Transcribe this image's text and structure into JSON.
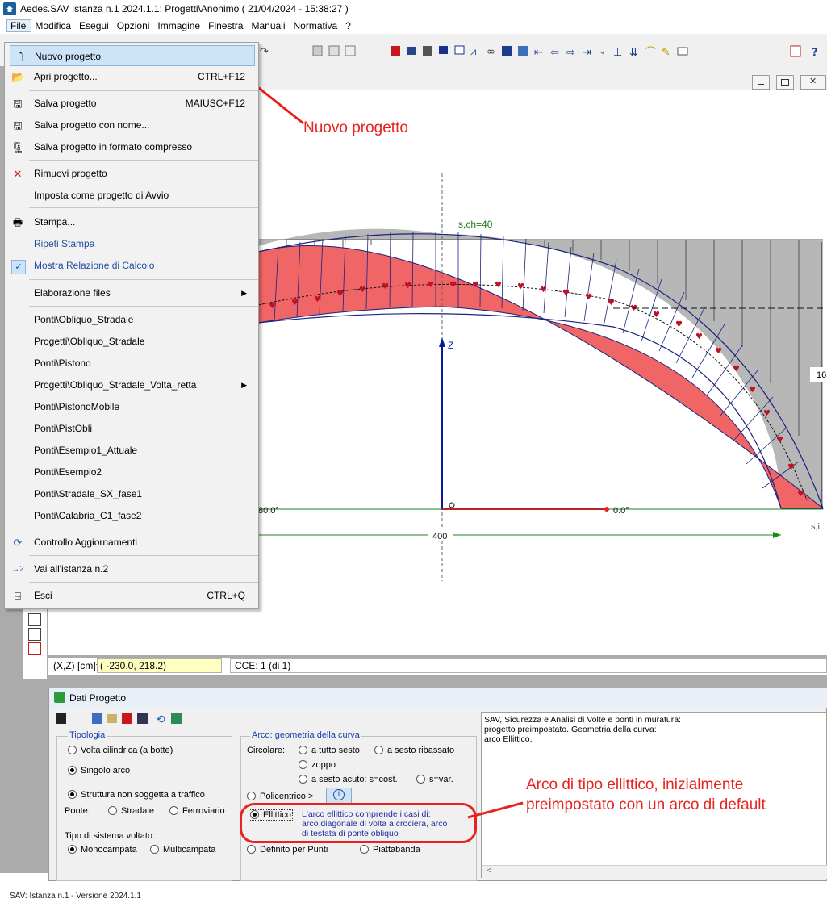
{
  "title_bar": {
    "text": "Aedes.SAV Istanza n.1 2024.1.1: Progetti\\Anonimo  ( 21/04/2024 - 15:38:27 )"
  },
  "menubar": [
    "File",
    "Modifica",
    "Esegui",
    "Opzioni",
    "Immagine",
    "Finestra",
    "Manuali",
    "Normativa",
    "?"
  ],
  "file_menu": [
    {
      "label": "Nuovo progetto",
      "icon": "new-document-icon",
      "shortcut": ""
    },
    {
      "label": "Apri progetto...",
      "icon": "open-folder-icon",
      "shortcut": "CTRL+F12"
    },
    {
      "label": "Salva progetto",
      "icon": "floppy-disk-icon",
      "shortcut": "MAIUSC+F12"
    },
    {
      "label": "Salva progetto con nome...",
      "icon": "floppy-save-as-icon",
      "shortcut": ""
    },
    {
      "label": "Salva progetto in formato compresso",
      "icon": "compressed-save-icon",
      "shortcut": ""
    },
    {
      "label": "Rimuovi progetto",
      "icon": "red-x-icon",
      "shortcut": ""
    },
    {
      "label": "Imposta come progetto di Avvio",
      "icon": "",
      "shortcut": ""
    },
    {
      "label": "Stampa...",
      "icon": "printer-icon",
      "shortcut": ""
    },
    {
      "label": "Ripeti Stampa",
      "icon": "",
      "shortcut": ""
    },
    {
      "label": "Mostra Relazione di Calcolo",
      "icon": "checkmark-icon",
      "shortcut": ""
    },
    {
      "label": "Elaborazione files",
      "icon": "",
      "shortcut": ""
    },
    {
      "label": "Ponti\\Obliquo_Stradale",
      "icon": "",
      "shortcut": ""
    },
    {
      "label": "Progetti\\Obliquo_Stradale",
      "icon": "",
      "shortcut": ""
    },
    {
      "label": "Ponti\\Pistono",
      "icon": "",
      "shortcut": ""
    },
    {
      "label": "Progetti\\Obliquo_Stradale_Volta_retta",
      "icon": "",
      "shortcut": ""
    },
    {
      "label": "Ponti\\PistonoMobile",
      "icon": "",
      "shortcut": ""
    },
    {
      "label": "Ponti\\PistObli",
      "icon": "",
      "shortcut": ""
    },
    {
      "label": "Ponti\\Esempio1_Attuale",
      "icon": "",
      "shortcut": ""
    },
    {
      "label": "Ponti\\Esempio2",
      "icon": "",
      "shortcut": ""
    },
    {
      "label": "Ponti\\Stradale_SX_fase1",
      "icon": "",
      "shortcut": ""
    },
    {
      "label": "Ponti\\Calabria_C1_fase2",
      "icon": "",
      "shortcut": ""
    },
    {
      "label": "Controllo Aggiornamenti",
      "icon": "refresh-icon",
      "shortcut": ""
    },
    {
      "label": "Vai all'istanza n.2",
      "icon": "instance-2-icon",
      "shortcut": ""
    },
    {
      "label": "Esci",
      "icon": "exit-door-icon",
      "shortcut": "CTRL+Q"
    }
  ],
  "annotations": {
    "new_project": "Nuovo progetto",
    "ellipse_line1": "Arco di tipo ellittico, inizialmente",
    "ellipse_line2": "preimpostato con un arco di default"
  },
  "drawing": {
    "s_ch": "s,ch=40",
    "z_axis": "Z",
    "angle_left": "80.0°",
    "angle_right": "0.0°",
    "span": "400",
    "height": "16",
    "s_label": "s,i"
  },
  "coords": {
    "label": "(X,Z) [cm]=",
    "value": "( -230.0, 218.2)",
    "cce": "CCE: 1  (di 1)"
  },
  "dati_progetto": {
    "title": "Dati Progetto",
    "tipologia": {
      "legend": "Tipologia",
      "volta_cilindrica": "Volta cilindrica (a botte)",
      "singolo_arco": "Singolo arco",
      "struttura": "Struttura non soggetta a traffico",
      "ponte": "Ponte:",
      "stradale": "Stradale",
      "ferroviario": "Ferroviario",
      "tipo_sistema": "Tipo di sistema voltato:",
      "monocampata": "Monocampata",
      "multicampata": "Multicampata"
    },
    "arco": {
      "legend": "Arco: geometria della curva",
      "circolare": "Circolare:",
      "tutto_sesto": "a tutto sesto",
      "sesto_ribassato": "a sesto ribassato",
      "zoppo": "zoppo",
      "sesto_acuto": "a sesto acuto: s=cost.",
      "s_var": "s=var.",
      "policentrico": "Policentrico >",
      "ellittico": "Ellittico",
      "ellittico_desc1": "L'arco ellittico comprende i casi di:",
      "ellittico_desc2": "arco diagonale di volta a crociera, arco",
      "ellittico_desc3": "di testata di ponte obliquo",
      "definito_punti": "Definito per Punti",
      "piattabanda": "Piattabanda"
    },
    "info": {
      "line1": "SAV, Sicurezza e Analisi di Volte e ponti in muratura:",
      "line2": "progetto preimpostato. Geometria della curva:",
      "line3": "arco Ellittico."
    }
  },
  "status": "SAV: Istanza n.1 - Versione 2024.1.1",
  "colors": {
    "arch_fill": "#f06565",
    "accent_red": "#e8231f",
    "grey_fill": "#b4b4b4",
    "axis_blue": "#0a1aa0",
    "axis_green": "#1a8a1a"
  }
}
